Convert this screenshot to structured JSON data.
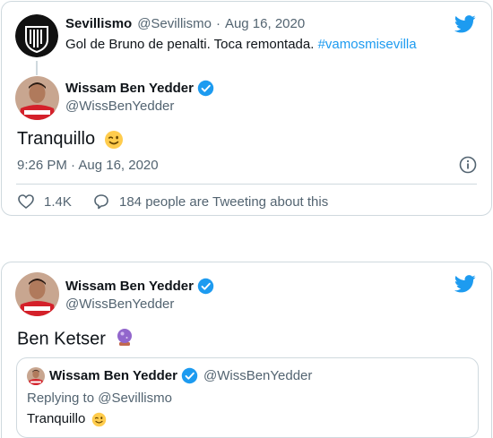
{
  "tweet1": {
    "reply_to": {
      "name": "Sevillismo",
      "handle": "@Sevillismo",
      "separator": "·",
      "date": "Aug 16, 2020",
      "text": "Gol de Bruno de penalti. Toca remontada.",
      "hashtag": "#vamosmisevilla"
    },
    "author": {
      "name": "Wissam Ben Yedder",
      "handle": "@WissBenYedder",
      "verified": true
    },
    "text": "Tranquillo",
    "emoji": "winking-face",
    "timestamp": "9:26 PM · Aug 16, 2020",
    "likes": "1.4K",
    "activity": "184 people are Tweeting about this"
  },
  "tweet2": {
    "author": {
      "name": "Wissam Ben Yedder",
      "handle": "@WissBenYedder",
      "verified": true
    },
    "text": "Ben Ketser",
    "emoji": "crystal-ball",
    "quoted": {
      "name": "Wissam Ben Yedder",
      "handle": "@WissBenYedder",
      "replying": "Replying to @Sevillismo",
      "text": "Tranquillo",
      "emoji": "winking-face"
    }
  },
  "colors": {
    "accent": "#1d9bf0",
    "border": "#cfd9de",
    "muted": "#536471",
    "text": "#0f1419",
    "monaco_red": "#d4202a"
  }
}
